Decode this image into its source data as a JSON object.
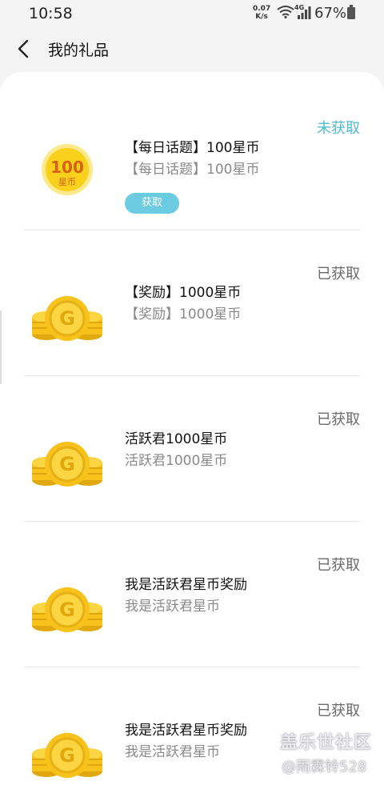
{
  "status_bar": {
    "time": "10:58",
    "speed_value": "0.07",
    "speed_unit": "K/s",
    "network": "4G",
    "battery": "67%"
  },
  "header": {
    "title": "我的礼品"
  },
  "gifts": [
    {
      "name": "【每日话题】100星币",
      "desc": "【每日话题】100星币",
      "status": "未获取",
      "action": "获取",
      "badge_value": "100",
      "badge_unit": "星币",
      "icon": "star-coin-badge-icon"
    },
    {
      "name": "【奖励】1000星币",
      "desc": "【奖励】1000星币",
      "status": "已获取",
      "icon": "gold-coin-stack-icon"
    },
    {
      "name": "活跃君1000星币",
      "desc": "活跃君1000星币",
      "status": "已获取",
      "icon": "gold-coin-stack-icon"
    },
    {
      "name": "我是活跃君星币奖励",
      "desc": "我是活跃君星币",
      "status": "已获取",
      "icon": "gold-coin-stack-icon"
    },
    {
      "name": "我是活跃君星币奖励",
      "desc": "我是活跃君星币",
      "status": "已获取",
      "icon": "gold-coin-stack-icon"
    }
  ],
  "watermark": {
    "line1": "盖乐世社区",
    "line2": "@雨霖铃528"
  },
  "colors": {
    "pending": "#4fbcd0",
    "done": "#6b6b6b",
    "button": "#6bcbe0",
    "coin": "#f7c21b"
  }
}
